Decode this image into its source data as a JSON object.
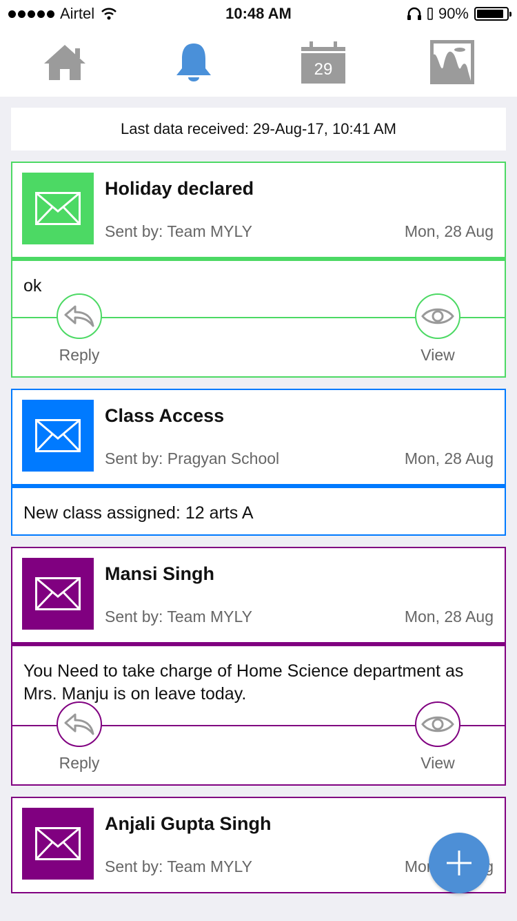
{
  "status_bar": {
    "carrier": "Airtel",
    "time": "10:48 AM",
    "battery": "90%",
    "battery_level": 0.9
  },
  "nav": {
    "items": [
      {
        "name": "home-icon",
        "active": false
      },
      {
        "name": "bell-icon",
        "active": true
      },
      {
        "name": "calendar-icon",
        "active": false,
        "day": "29"
      },
      {
        "name": "gallery-icon",
        "active": false
      }
    ],
    "active_color": "#4a90d9",
    "inactive_color": "#9b9b9b"
  },
  "last_data": "Last data received: 29-Aug-17, 10:41 AM",
  "cards": [
    {
      "title": "Holiday declared",
      "sender": "Sent by: Team MYLY",
      "date": "Mon, 28 Aug",
      "message": "ok",
      "color": "#4cd964",
      "has_actions": true,
      "reply_label": "Reply",
      "view_label": "View"
    },
    {
      "title": "Class Access",
      "sender": "Sent by: Pragyan School",
      "date": "Mon, 28 Aug",
      "message": "New class assigned: 12 arts A",
      "color": "#007aff",
      "has_actions": false
    },
    {
      "title": "Mansi Singh",
      "sender": "Sent by: Team MYLY",
      "date": "Mon, 28 Aug",
      "message": "You Need to take charge of Home Science department as Mrs. Manju is on leave today.",
      "color": "#800080",
      "has_actions": true,
      "reply_label": "Reply",
      "view_label": "View"
    },
    {
      "title": "Anjali Gupta Singh",
      "sender": "Sent by: Team MYLY",
      "date": "Mon, 28 Aug",
      "color": "#800080",
      "has_actions": false
    }
  ],
  "fab": {
    "icon": "plus-icon",
    "color": "#4d8fd6"
  }
}
